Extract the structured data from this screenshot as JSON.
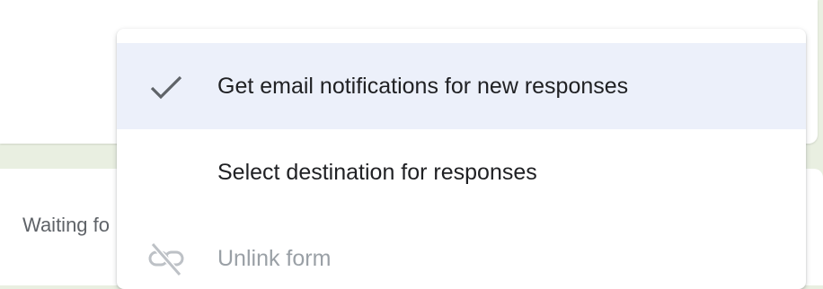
{
  "background_card": {
    "status_text": "Waiting fo"
  },
  "menu": {
    "items": [
      {
        "label": "Get email notifications for new responses",
        "icon": "check-icon",
        "checked": true,
        "highlighted": true,
        "disabled": false
      },
      {
        "label": "Select destination for responses",
        "icon": "",
        "checked": false,
        "highlighted": false,
        "disabled": false
      },
      {
        "label": "Unlink form",
        "icon": "link-off-icon",
        "checked": false,
        "highlighted": false,
        "disabled": true
      }
    ]
  },
  "colors": {
    "highlight_bg": "#ecf0fa",
    "text_primary": "#202124",
    "text_disabled": "#9aa0a6",
    "icon_gray": "#5f6368",
    "page_band": "#e9efe1"
  }
}
